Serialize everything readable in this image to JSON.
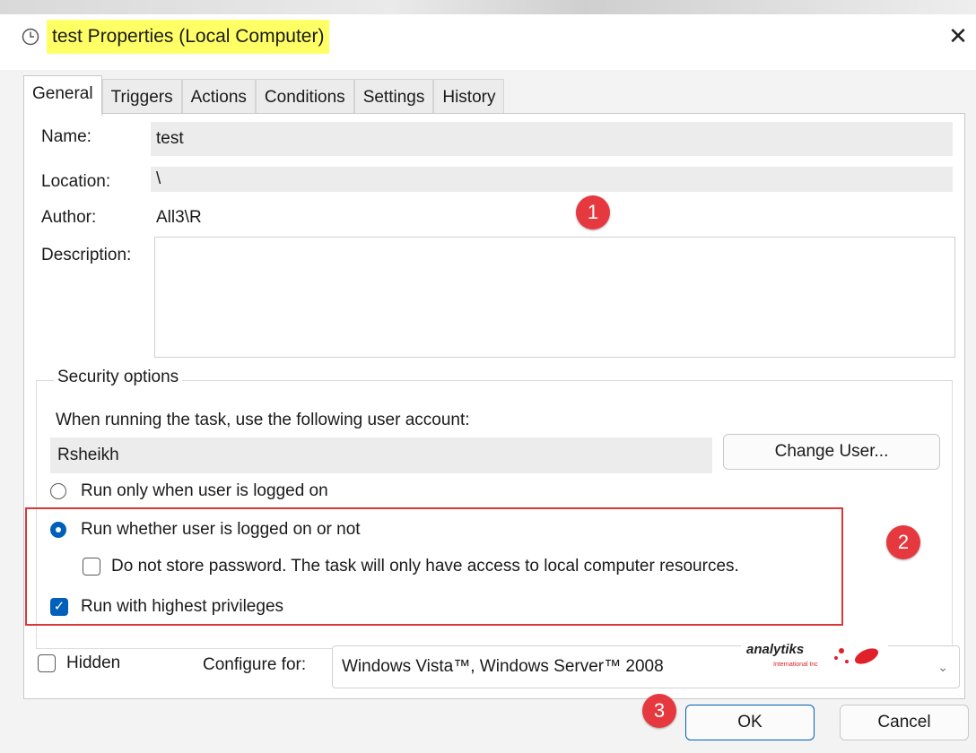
{
  "window": {
    "title": "test Properties (Local Computer)",
    "close": "✕"
  },
  "tabs": [
    "General",
    "Triggers",
    "Actions",
    "Conditions",
    "Settings",
    "History"
  ],
  "general": {
    "name_label": "Name:",
    "name_value": "test",
    "location_label": "Location:",
    "location_value": "\\",
    "author_label": "Author:",
    "author_value": "All3\\R",
    "description_label": "Description:",
    "description_value": ""
  },
  "security": {
    "group_label": "Security options",
    "account_prompt": "When running the task, use the following user account:",
    "account_value": "Rsheikh",
    "change_user": "Change User...",
    "radio_logged_on": "Run only when user is logged on",
    "radio_whether": "Run whether user is logged on or not",
    "no_store_password": "Do not store password.  The task will only have access to local computer resources.",
    "highest_privileges": "Run with highest privileges",
    "selected_radio": "radio_whether",
    "no_store_password_checked": false,
    "highest_privileges_checked": true
  },
  "bottom": {
    "hidden_label": "Hidden",
    "hidden_checked": false,
    "configure_label": "Configure for:",
    "configure_value": "Windows Vista™, Windows Server™ 2008",
    "ok": "OK",
    "cancel": "Cancel"
  },
  "annotations": [
    "1",
    "2",
    "3"
  ],
  "logo": {
    "name": "analytiks",
    "tagline": "International Inc"
  },
  "colors": {
    "accent": "#005fb8",
    "badge": "#e5393f",
    "highlight": "#ffff66",
    "frame": "#d93838"
  },
  "icons": {
    "title": "clock-icon",
    "dropdown": "chevron-down-icon"
  }
}
